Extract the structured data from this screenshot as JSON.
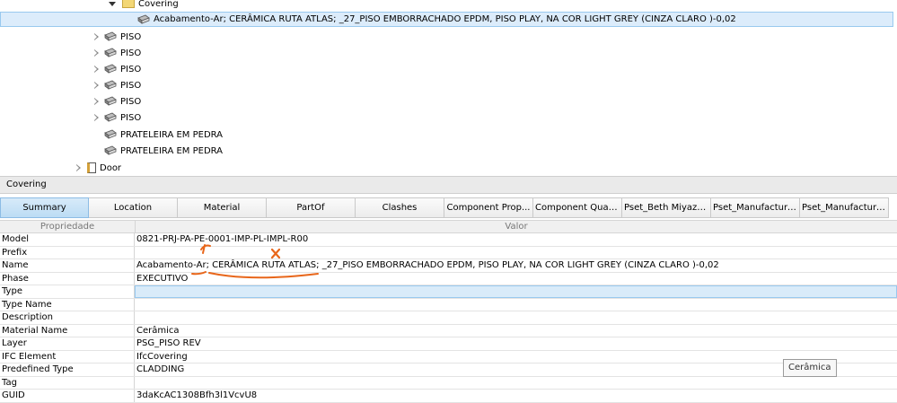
{
  "tree": {
    "covering_label": "Covering",
    "selected_item": "Acabamento-Ar; CERÂMICA RUTA ATLAS; _27_PISO EMBORRACHADO EPDM, PISO PLAY, NA COR LIGHT GREY (CINZA CLARO )-0,02",
    "piso_items": [
      "PISO",
      "PISO",
      "PISO",
      "PISO",
      "PISO",
      "PISO"
    ],
    "prateleira_items": [
      "PRATELEIRA EM PEDRA",
      "PRATELEIRA EM PEDRA"
    ],
    "door_label": "Door"
  },
  "section_title": "Covering",
  "tabs": [
    "Summary",
    "Location",
    "Material",
    "PartOf",
    "Clashes",
    "Component Prop...",
    "Component Quan...",
    "Pset_Beth Miyazaki",
    "Pset_Manufacture...",
    "Pset_Manufacturer..."
  ],
  "grid": {
    "col_property": "Propriedade",
    "col_value": "Valor",
    "rows": [
      {
        "k": "Model",
        "v": "0821-PRJ-PA-PE-0001-IMP-PL-IMPL-R00"
      },
      {
        "k": "Prefix",
        "v": ""
      },
      {
        "k": "Name",
        "v": "Acabamento-Ar; CERÂMICA RUTA ATLAS; _27_PISO EMBORRACHADO EPDM, PISO PLAY, NA COR LIGHT GREY (CINZA CLARO )-0,02"
      },
      {
        "k": "Phase",
        "v": "EXECUTIVO"
      },
      {
        "k": "Type",
        "v": ""
      },
      {
        "k": "Type Name",
        "v": ""
      },
      {
        "k": "Description",
        "v": ""
      },
      {
        "k": "Material Name",
        "v": "Cerâmica"
      },
      {
        "k": "Layer",
        "v": "PSG_PISO REV"
      },
      {
        "k": "IFC Element",
        "v": "IfcCovering"
      },
      {
        "k": "Predefined Type",
        "v": "CLADDING"
      },
      {
        "k": "Tag",
        "v": ""
      },
      {
        "k": "GUID",
        "v": "3daKcAC1308Bfh3l1VcvU8"
      }
    ]
  },
  "tooltip": "Cerâmica",
  "colors": {
    "selection_bg": "#dcecfb",
    "selection_border": "#99c9ef",
    "annotation": "#e8661a"
  }
}
